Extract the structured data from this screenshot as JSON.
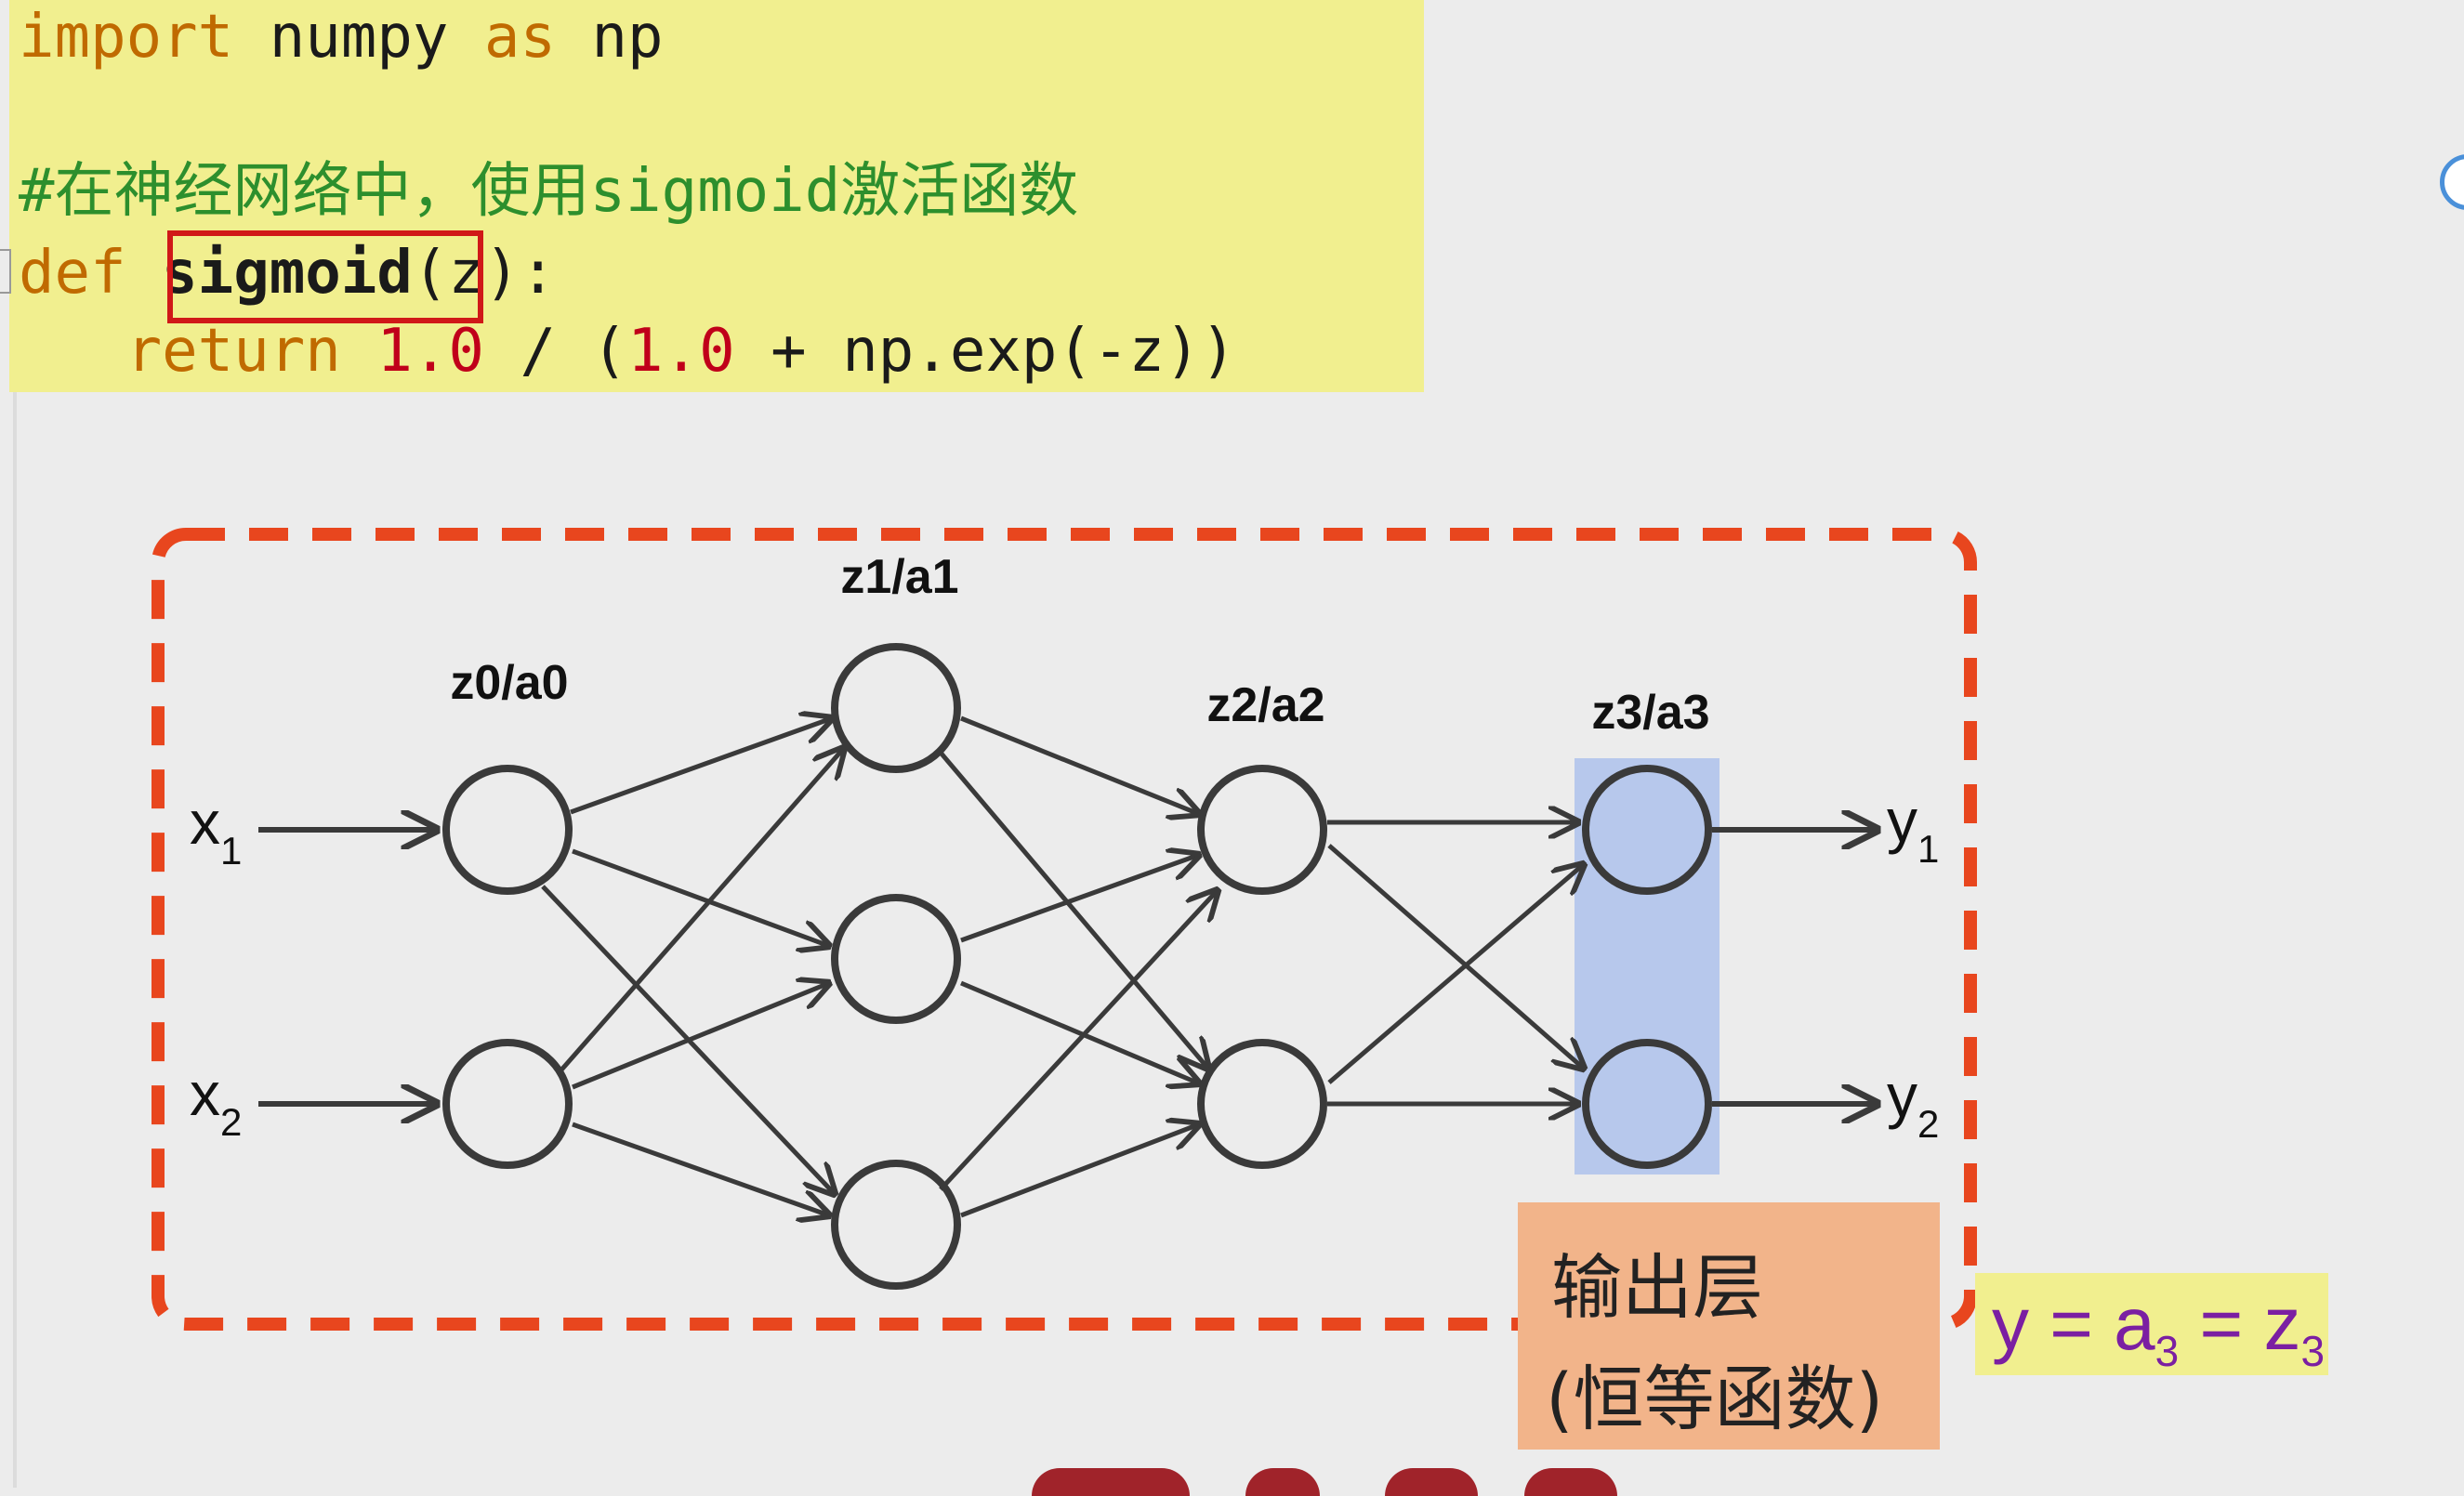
{
  "code": {
    "line1": {
      "kw1": "import",
      "mid": " numpy ",
      "kw2": "as",
      "tail": " np"
    },
    "comment": "#在神经网络中，使用sigmoid激活函数",
    "line3": {
      "kw": "def",
      "sp": " ",
      "fn": "sigmoid",
      "args": "(z):"
    },
    "line4": {
      "indent": "   ",
      "kw": "return",
      "sp1": " ",
      "n1": "1.0",
      "op1": " / (",
      "n2": "1.0",
      "tail": " + np.exp(-z))"
    }
  },
  "diagram": {
    "layers": [
      {
        "label": "z0/a0"
      },
      {
        "label": "z1/a1"
      },
      {
        "label": "z2/a2"
      },
      {
        "label": "z3/a3"
      }
    ],
    "inputs": [
      {
        "main": "x",
        "sub": "1"
      },
      {
        "main": "x",
        "sub": "2"
      }
    ],
    "outputs": [
      {
        "main": "y",
        "sub": "1"
      },
      {
        "main": "y",
        "sub": "2"
      }
    ],
    "colors": {
      "dashed_border": "#e8461e",
      "output_highlight": "#b7c8ec",
      "node_stroke": "#3a3a3a",
      "edge": "#3a3a3a"
    }
  },
  "output_box": {
    "line1": "输出层",
    "line2": "(恒等函数)"
  },
  "equation": {
    "y": "y = a",
    "a_sub": "3",
    "eq": " = z",
    "z_sub": "3"
  }
}
